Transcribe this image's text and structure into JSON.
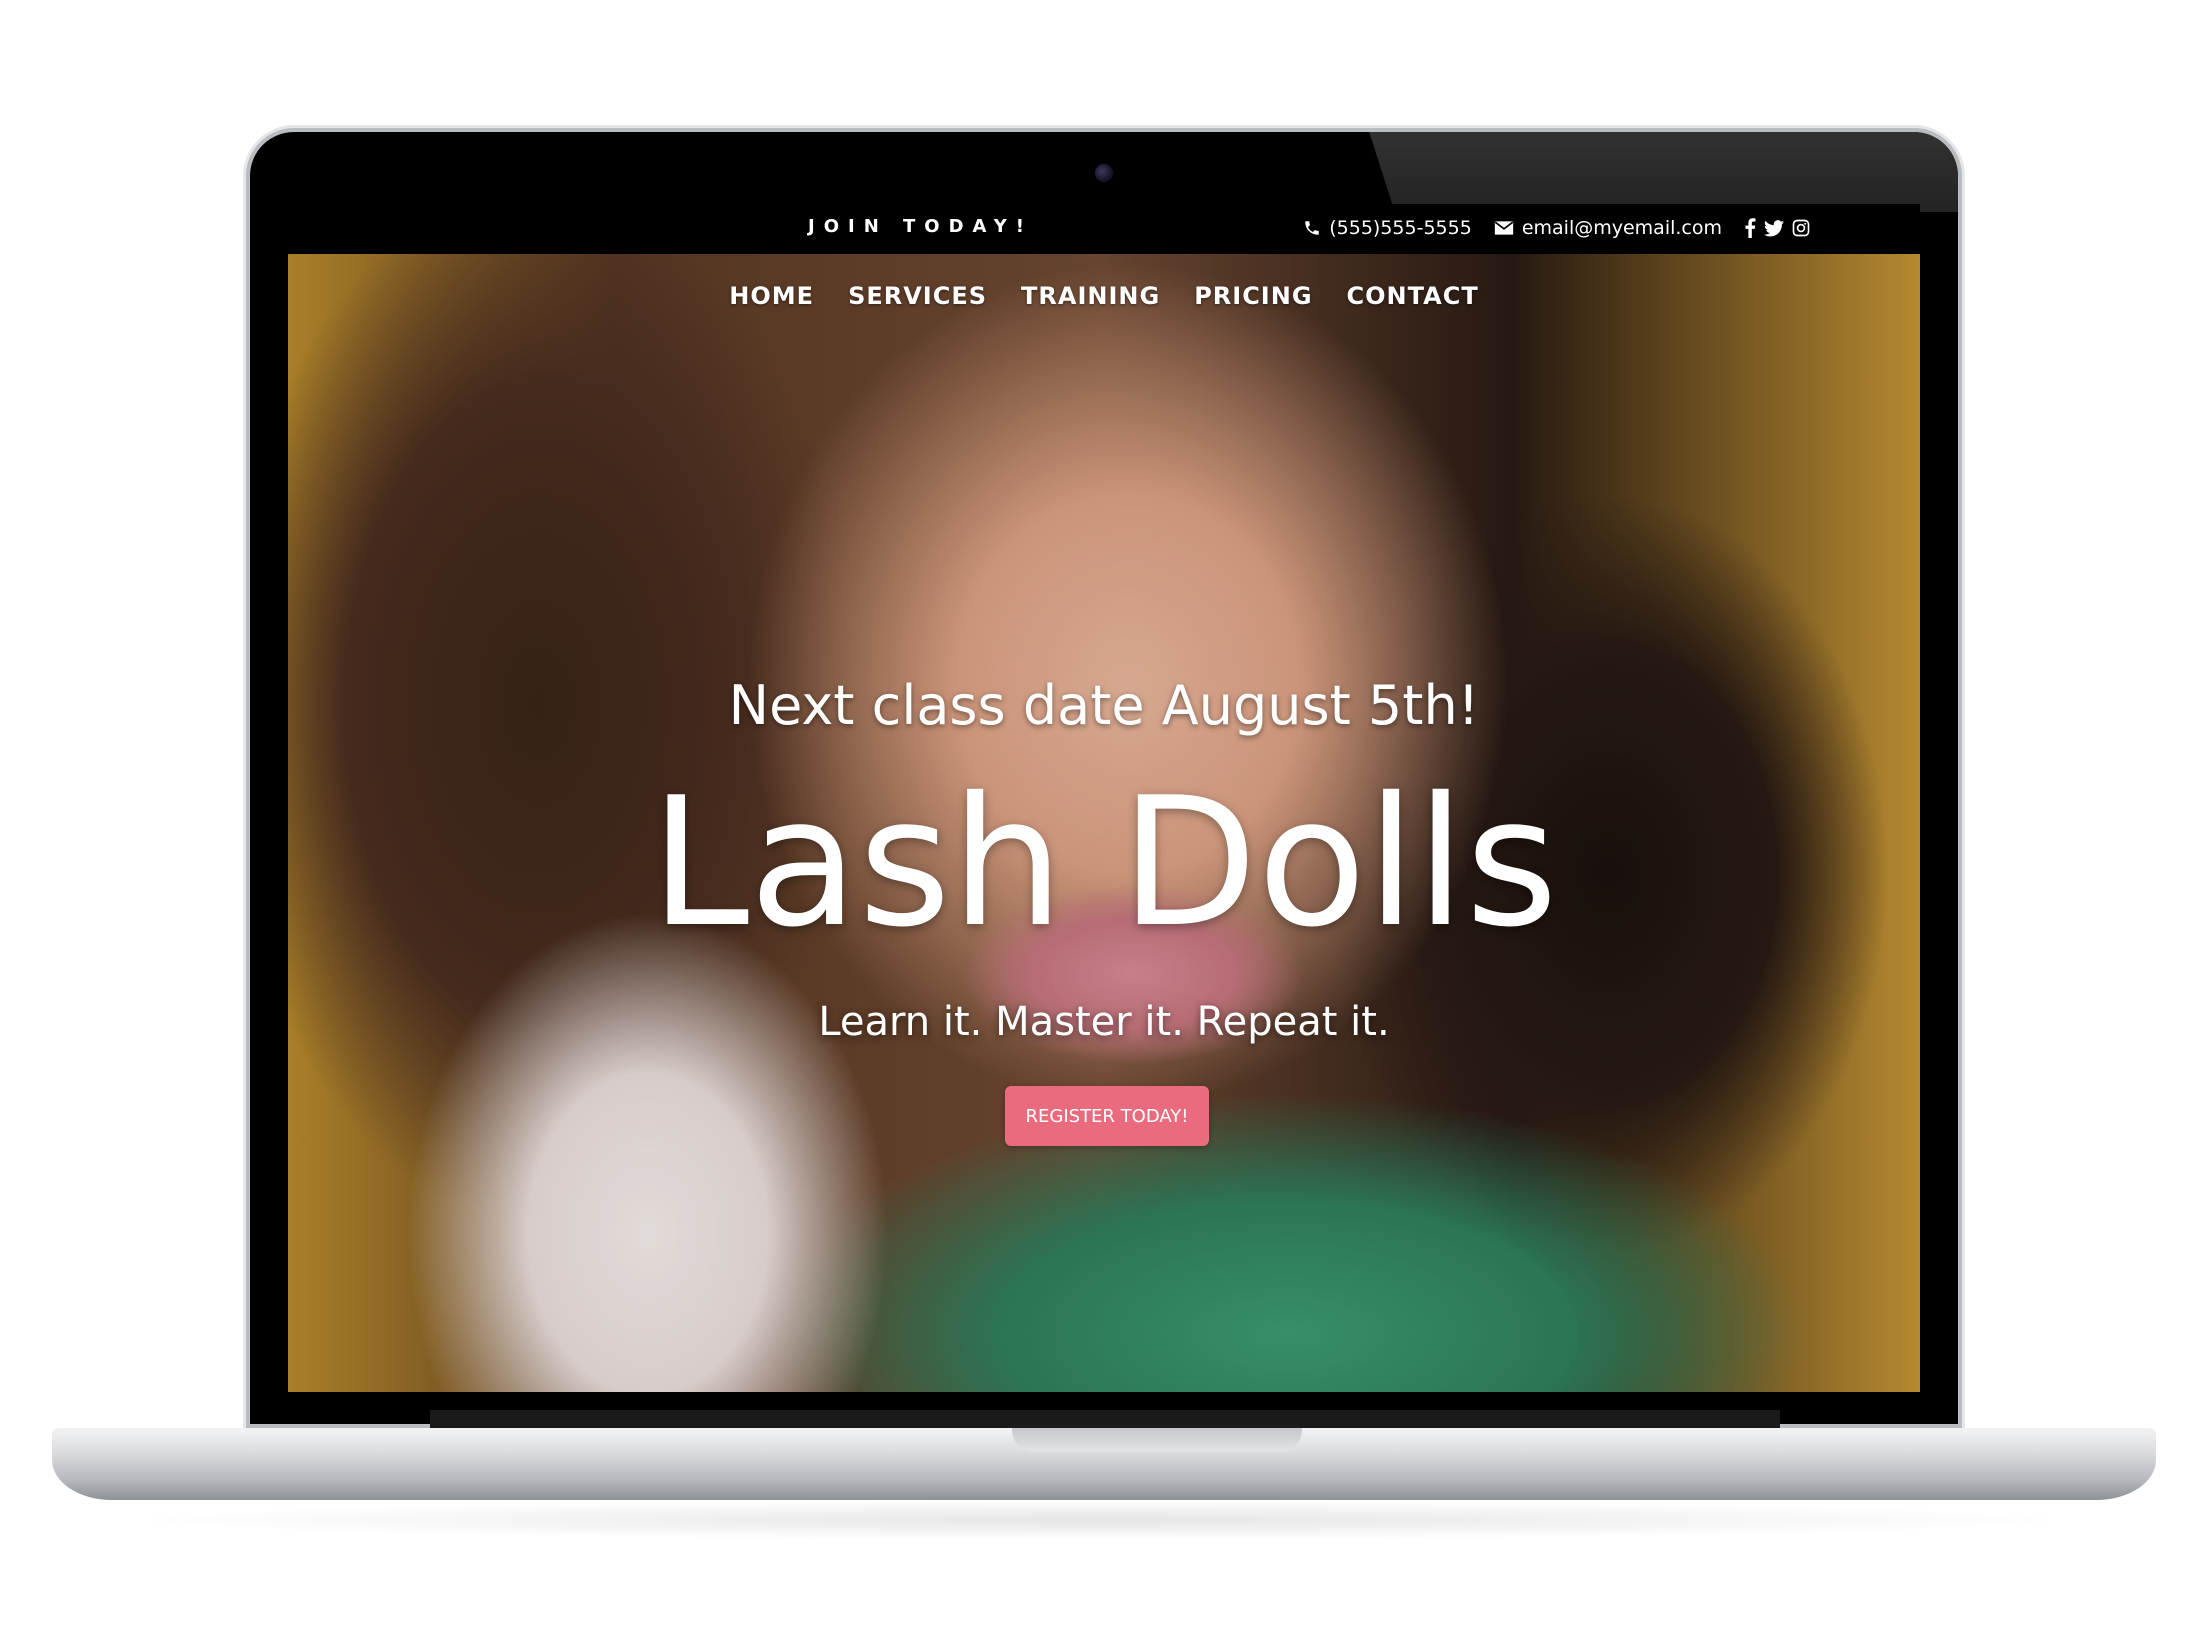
{
  "topbar": {
    "join_text": "JOIN TODAY!",
    "phone": "(555)555-5555",
    "email": "email@myemail.com",
    "phone_icon": "phone-icon",
    "email_icon": "envelope-icon",
    "social_icons": [
      "facebook-icon",
      "twitter-icon",
      "instagram-icon"
    ]
  },
  "nav": {
    "items": [
      {
        "label": "HOME"
      },
      {
        "label": "SERVICES"
      },
      {
        "label": "TRAINING"
      },
      {
        "label": "PRICING"
      },
      {
        "label": "CONTACT"
      }
    ]
  },
  "hero": {
    "next_class": "Next class date August 5th!",
    "title": "Lash Dolls",
    "tagline": "Learn it. Master it. Repeat it.",
    "cta_label": "REGISTER TODAY!"
  },
  "colors": {
    "cta": "#ea6b7d",
    "topbar_bg": "#000000",
    "text": "#ffffff"
  }
}
